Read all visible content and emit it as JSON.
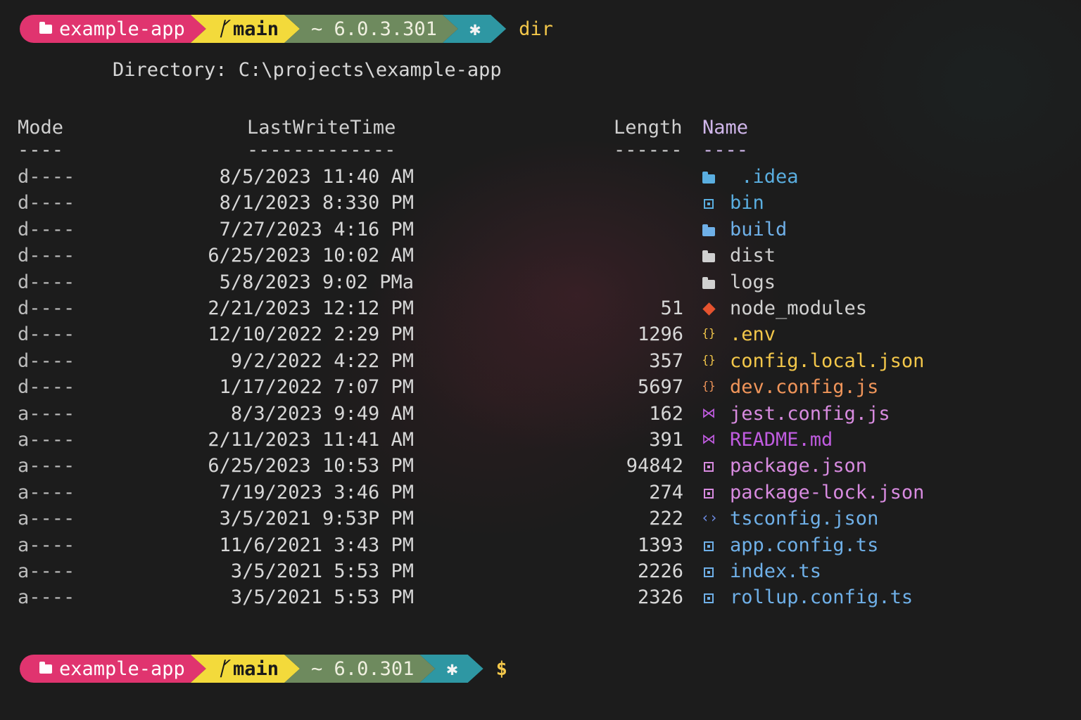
{
  "prompt_top": {
    "folder": "example-app",
    "branch": "main",
    "dotnet": "~ 6.0.3.301",
    "shell_icon": "plug-icon",
    "command": "dir"
  },
  "prompt_bottom": {
    "folder": "example-app",
    "branch": "main",
    "dotnet": "~ 6.0.301",
    "shell_icon": "plug-icon",
    "symbol": "$"
  },
  "directory": {
    "label": "Directory: C:\\projects\\example-app"
  },
  "headers": {
    "mode": "Mode",
    "mode_rule": "----",
    "time": "LastWriteTime",
    "time_rule": "-------------",
    "length": "Length",
    "length_rule": "------",
    "name": "Name",
    "name_rule": "----"
  },
  "colors": {
    "folder_blue": "#5aaee0",
    "folder_gray": "#d0d0d0",
    "yellow": "#f3c74a",
    "orange": "#f0955a",
    "magenta": "#c05ce0",
    "pink": "#d88be0",
    "blue": "#6fb0e8"
  },
  "rows": [
    {
      "mode": "d----",
      "time": "8/5/2023 11:40 AM",
      "length": "",
      "icon": "folder-icon",
      "name": " .idea",
      "color": "#5aaee0"
    },
    {
      "mode": "d----",
      "time": "8/1/2023 8:330 PM",
      "length": "",
      "icon": "bin-icon",
      "name": "bin",
      "color": "#5aaee0"
    },
    {
      "mode": "d----",
      "time": "7/27/2023 4:16 PM",
      "length": "",
      "icon": "folder-icon",
      "name": "build",
      "color": "#6fb0e8"
    },
    {
      "mode": "d----",
      "time": "6/25/2023 10:02 AM",
      "length": "",
      "icon": "folder-icon",
      "name": "dist",
      "color": "#d0d0d0"
    },
    {
      "mode": "d----",
      "time": "5/8/2023 9:02 PMa",
      "length": "",
      "icon": "folder-icon",
      "name": "logs",
      "color": "#d0d0d0"
    },
    {
      "mode": "d----",
      "time": "2/21/2023 12:12 PM",
      "length": "51",
      "icon": "npm-icon",
      "name": "node_modules",
      "color": "#d0d0d0"
    },
    {
      "mode": "d----",
      "time": "12/10/2022 2:29 PM",
      "length": "1296",
      "icon": "braces-icon",
      "name": ".env",
      "color": "#f3c74a"
    },
    {
      "mode": "d----",
      "time": "9/2/2022 4:22 PM",
      "length": "357",
      "icon": "braces-icon",
      "name": "config.local.json",
      "color": "#f3c74a"
    },
    {
      "mode": "d----",
      "time": "1/17/2022 7:07 PM",
      "length": "5697",
      "icon": "braces-icon",
      "name": "dev.config.js",
      "color": "#f0955a"
    },
    {
      "mode": "a----",
      "time": "8/3/2023 9:49 AM",
      "length": "162",
      "icon": "vscode-icon",
      "name": "jest.config.js",
      "color": "#d88be0"
    },
    {
      "mode": "a----",
      "time": "2/11/2023 11:41 AM",
      "length": "391",
      "icon": "vscode-icon",
      "name": "README.md",
      "color": "#c05ce0"
    },
    {
      "mode": "a----",
      "time": "6/25/2023 10:53 PM",
      "length": "94842",
      "icon": "file-icon",
      "name": "package.json",
      "color": "#d88be0"
    },
    {
      "mode": "a----",
      "time": "7/19/2023 3:46 PM",
      "length": "274",
      "icon": "file-icon",
      "name": "package-lock.json",
      "color": "#d88be0"
    },
    {
      "mode": "a----",
      "time": "3/5/2021 9:53P PM",
      "length": "222",
      "icon": "code-icon",
      "name": "tsconfig.json",
      "color": "#6fb0e8"
    },
    {
      "mode": "a----",
      "time": "11/6/2021 3:43 PM",
      "length": "1393",
      "icon": "file-icon",
      "name": "app.config.ts",
      "color": "#6fb0e8"
    },
    {
      "mode": "a----",
      "time": "3/5/2021 5:53 PM",
      "length": "2226",
      "icon": "file-icon",
      "name": "index.ts",
      "color": "#6fb0e8"
    },
    {
      "mode": "a----",
      "time": "3/5/2021 5:53 PM",
      "length": "2326",
      "icon": "file-icon",
      "name": "rollup.config.ts",
      "color": "#6fb0e8"
    }
  ]
}
